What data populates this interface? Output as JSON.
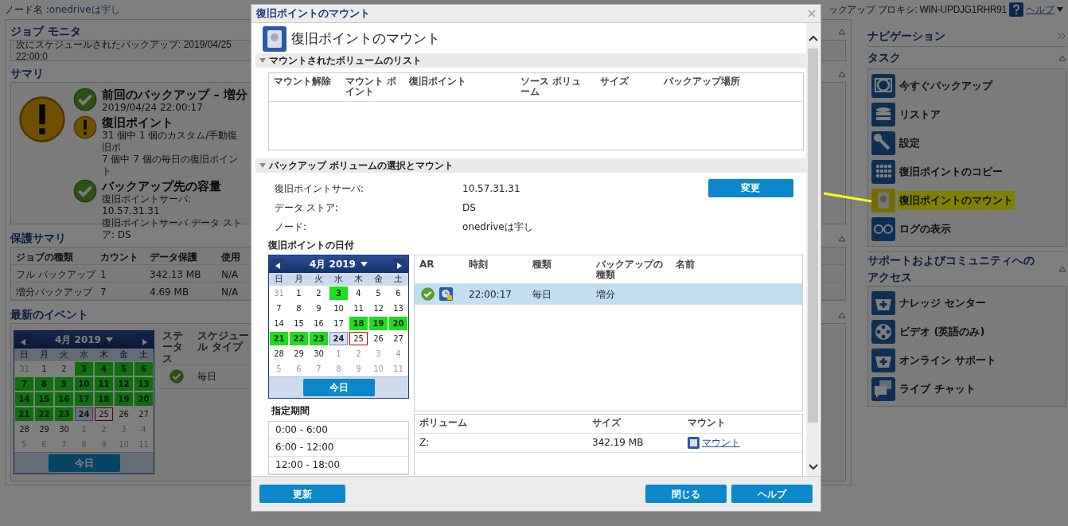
{
  "top_bar": {
    "node_label": "ノード名 :",
    "node_name": "onedriveは宇し",
    "proxy": "ックアップ プロキシ: WIN-UPDJG1RHR91",
    "help": "ヘルプ"
  },
  "job_monitor": {
    "title": "ジョブ モニタ",
    "next_backup": "次にスケジュールされたバックアップ: 2019/04/25 22:00:0"
  },
  "summary": {
    "title": "サマリ",
    "overall": {
      "kind": "warning"
    },
    "items": [
      {
        "kind": "ok",
        "title": "前回のバックアップ – 増分",
        "lines": [
          "2019/04/24 22:00:17"
        ]
      },
      {
        "kind": "warning",
        "title": "復旧ポイント",
        "lines": [
          "31 個中 1 個のカスタム/手動復旧ポ",
          "7 個中 7 個の毎日の復旧ポイント"
        ]
      },
      {
        "kind": "ok",
        "title": "バックアップ先の容量",
        "lines": [
          "復旧ポイントサーバ: 10.57.31.31",
          "復旧ポイントサーバ データ ストア: DS"
        ]
      }
    ]
  },
  "protection_summary": {
    "title": "保護サマリ",
    "columns": [
      "ジョブの種類",
      "カウント",
      "データ保護",
      "使用"
    ],
    "rows": [
      [
        "フル バックアップ",
        "1",
        "342.13 MB",
        "N/A"
      ],
      [
        "増分バックアップ",
        "7",
        "4.69 MB",
        "N/A"
      ]
    ]
  },
  "recent_events": {
    "title": "最新のイベント",
    "calendar": {
      "month": "4月 2019",
      "weekdays": [
        "日",
        "月",
        "火",
        "水",
        "木",
        "金",
        "土"
      ],
      "today_button": "今日",
      "weeks": [
        [
          {
            "day": "31",
            "kind": "other"
          },
          {
            "day": "1",
            "kind": "normal"
          },
          {
            "day": "2",
            "kind": "normal"
          },
          {
            "day": "3",
            "kind": "backup"
          },
          {
            "day": "4",
            "kind": "backup"
          },
          {
            "day": "5",
            "kind": "backup"
          },
          {
            "day": "6",
            "kind": "backup"
          }
        ],
        [
          {
            "day": "7",
            "kind": "backup"
          },
          {
            "day": "8",
            "kind": "backup"
          },
          {
            "day": "9",
            "kind": "backup"
          },
          {
            "day": "10",
            "kind": "backup"
          },
          {
            "day": "11",
            "kind": "backup"
          },
          {
            "day": "12",
            "kind": "backup"
          },
          {
            "day": "13",
            "kind": "backup"
          }
        ],
        [
          {
            "day": "14",
            "kind": "backup"
          },
          {
            "day": "15",
            "kind": "backup"
          },
          {
            "day": "16",
            "kind": "backup"
          },
          {
            "day": "17",
            "kind": "backup"
          },
          {
            "day": "18",
            "kind": "backup"
          },
          {
            "day": "19",
            "kind": "backup"
          },
          {
            "day": "20",
            "kind": "backup"
          }
        ],
        [
          {
            "day": "21",
            "kind": "backup"
          },
          {
            "day": "22",
            "kind": "backup"
          },
          {
            "day": "23",
            "kind": "backup"
          },
          {
            "day": "24",
            "kind": "selected"
          },
          {
            "day": "25",
            "kind": "today"
          },
          {
            "day": "26",
            "kind": "normal"
          },
          {
            "day": "27",
            "kind": "normal"
          }
        ],
        [
          {
            "day": "28",
            "kind": "normal"
          },
          {
            "day": "29",
            "kind": "normal"
          },
          {
            "day": "30",
            "kind": "normal"
          },
          {
            "day": "1",
            "kind": "other"
          },
          {
            "day": "2",
            "kind": "other"
          },
          {
            "day": "3",
            "kind": "other"
          },
          {
            "day": "4",
            "kind": "other"
          }
        ],
        [
          {
            "day": "5",
            "kind": "other"
          },
          {
            "day": "6",
            "kind": "other"
          },
          {
            "day": "7",
            "kind": "other"
          },
          {
            "day": "8",
            "kind": "other"
          },
          {
            "day": "9",
            "kind": "other"
          },
          {
            "day": "10",
            "kind": "other"
          },
          {
            "day": "11",
            "kind": "other"
          }
        ]
      ]
    },
    "columns": [
      "ステータス",
      "スケジュール タイプ"
    ],
    "rows": [
      {
        "kind": "ok",
        "schedule_type": "毎日"
      }
    ]
  },
  "navigation": {
    "title": "ナビゲーション",
    "tasks_title": "タスク",
    "tasks": [
      {
        "label": "今すぐバックアップ",
        "highlighted": false
      },
      {
        "label": "リストア",
        "highlighted": false
      },
      {
        "label": "設定",
        "highlighted": false
      },
      {
        "label": "復旧ポイントのコピー",
        "highlighted": false
      },
      {
        "label": "復旧ポイントのマウント",
        "highlighted": true
      },
      {
        "label": "ログの表示",
        "highlighted": false
      }
    ],
    "support_title": "サポートおよびコミュニティへのアクセス",
    "support_items": [
      {
        "label": "ナレッジ センター"
      },
      {
        "label": "ビデオ (英語のみ)"
      },
      {
        "label": "オンライン サポート"
      },
      {
        "label": "ライブ チャット"
      }
    ]
  },
  "dialog": {
    "title": "復旧ポイントのマウント",
    "heading": "復旧ポイントのマウント",
    "mounted_section": {
      "title": "マウントされたボリュームのリスト",
      "expanded": true,
      "columns": [
        "マウント解除",
        "マウント ポイント",
        "復旧ポイント",
        "ソース ボリューム",
        "サイズ",
        "バックアップ場所"
      ]
    },
    "select_section": {
      "title": "バックアップ ボリュームの選択とマウント",
      "expanded": true,
      "change_button": "変更",
      "fields": [
        {
          "label": "復旧ポイントサーバ:",
          "value": "10.57.31.31"
        },
        {
          "label": "データ ストア:",
          "value": "DS"
        },
        {
          "label": "ノード:",
          "value": "onedriveは宇し"
        }
      ]
    },
    "date_title": "復旧ポイントの日付",
    "calendar": {
      "month": "4月 2019",
      "weekdays": [
        "日",
        "月",
        "火",
        "水",
        "木",
        "金",
        "土"
      ],
      "today_button": "今日",
      "weeks": [
        [
          {
            "day": "31",
            "kind": "other"
          },
          {
            "day": "1",
            "kind": "normal"
          },
          {
            "day": "2",
            "kind": "normal"
          },
          {
            "day": "3",
            "kind": "backup"
          },
          {
            "day": "4",
            "kind": "normal"
          },
          {
            "day": "5",
            "kind": "normal"
          },
          {
            "day": "6",
            "kind": "normal"
          }
        ],
        [
          {
            "day": "7",
            "kind": "normal"
          },
          {
            "day": "8",
            "kind": "normal"
          },
          {
            "day": "9",
            "kind": "normal"
          },
          {
            "day": "10",
            "kind": "normal"
          },
          {
            "day": "11",
            "kind": "normal"
          },
          {
            "day": "12",
            "kind": "normal"
          },
          {
            "day": "13",
            "kind": "normal"
          }
        ],
        [
          {
            "day": "14",
            "kind": "normal"
          },
          {
            "day": "15",
            "kind": "normal"
          },
          {
            "day": "16",
            "kind": "normal"
          },
          {
            "day": "17",
            "kind": "normal"
          },
          {
            "day": "18",
            "kind": "backup"
          },
          {
            "day": "19",
            "kind": "backup"
          },
          {
            "day": "20",
            "kind": "backup"
          }
        ],
        [
          {
            "day": "21",
            "kind": "backup"
          },
          {
            "day": "22",
            "kind": "backup"
          },
          {
            "day": "23",
            "kind": "backup"
          },
          {
            "day": "24",
            "kind": "selected"
          },
          {
            "day": "25",
            "kind": "today"
          },
          {
            "day": "26",
            "kind": "normal"
          },
          {
            "day": "27",
            "kind": "normal"
          }
        ],
        [
          {
            "day": "28",
            "kind": "normal"
          },
          {
            "day": "29",
            "kind": "normal"
          },
          {
            "day": "30",
            "kind": "normal"
          },
          {
            "day": "1",
            "kind": "other"
          },
          {
            "day": "2",
            "kind": "other"
          },
          {
            "day": "3",
            "kind": "other"
          },
          {
            "day": "4",
            "kind": "other"
          }
        ],
        [
          {
            "day": "5",
            "kind": "other"
          },
          {
            "day": "6",
            "kind": "other"
          },
          {
            "day": "7",
            "kind": "other"
          },
          {
            "day": "8",
            "kind": "other"
          },
          {
            "day": "9",
            "kind": "other"
          },
          {
            "day": "10",
            "kind": "other"
          },
          {
            "day": "11",
            "kind": "other"
          }
        ]
      ]
    },
    "period_title": "指定期間",
    "periods": [
      {
        "label": "0:00 - 6:00",
        "selected": false
      },
      {
        "label": "6:00 - 12:00",
        "selected": false
      },
      {
        "label": "12:00 - 18:00",
        "selected": false
      }
    ],
    "points": {
      "columns": [
        "AR",
        "時刻",
        "種類",
        "バックアップの種類",
        "名前"
      ],
      "rows": [
        {
          "kind": "ok",
          "time": "22:00:17",
          "type": "毎日",
          "backup_type": "増分",
          "selected": true
        }
      ]
    },
    "volumes": {
      "columns": [
        "ボリューム",
        "サイズ",
        "マウント"
      ],
      "rows": [
        {
          "volume": "Z:",
          "size": "342.19 MB",
          "action": "マウント"
        }
      ]
    },
    "buttons": {
      "refresh": "更新",
      "close": "閉じる",
      "help": "ヘルプ"
    }
  }
}
